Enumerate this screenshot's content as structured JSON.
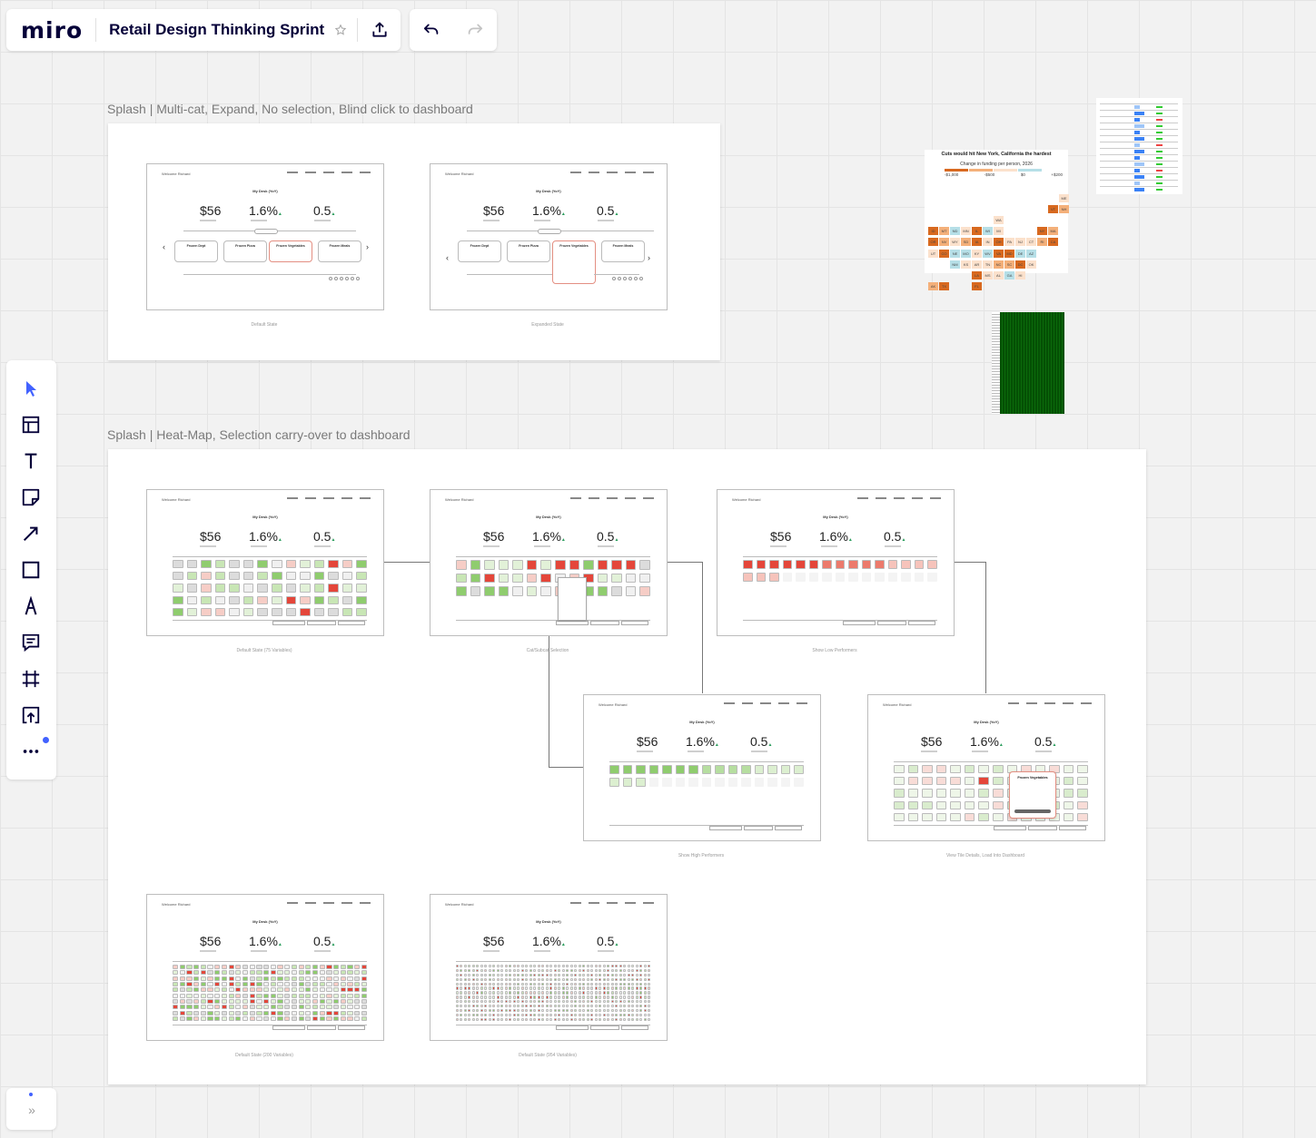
{
  "app": {
    "logo": "miro",
    "board_title": "Retail Design Thinking Sprint"
  },
  "colors": {
    "accent": "#4262ff",
    "frame_bg": "#ffffff",
    "canvas": "#f2f2f2",
    "heat_green": "#8fcc6e",
    "heat_red": "#e4463a"
  },
  "toolbar": {
    "tools": [
      "select-icon",
      "templates-icon",
      "text-icon",
      "sticky-note-icon",
      "connection-line-icon",
      "shape-icon",
      "pen-icon",
      "comment-icon",
      "frame-icon",
      "upload-icon",
      "more-icon"
    ]
  },
  "frames": [
    {
      "label": "Splash | Multi-cat, Expand, No selection, Blind click to dashboard"
    },
    {
      "label": "Splash | Heat-Map, Selection carry-over to dashboard"
    }
  ],
  "wireframe": {
    "welcome": "Welcome Richard",
    "title": "My Desk (YoY)",
    "metrics": [
      "$56",
      "1.6%",
      "0.5"
    ],
    "categories": [
      "Frozen Dept",
      "Frozen Pizza",
      "Frozen Vegetables",
      "Frozen Meals"
    ],
    "expanded_title": "Frozen Vegetables"
  },
  "captions": {
    "f1": [
      "Default State",
      "Expanded State"
    ],
    "f2": [
      "Default State (75 Variables)",
      "Cat/Subcat Selection",
      "Show Low Performers",
      "Show High Performers",
      "View Tile Details, Load Into Dashboard",
      "Default State (200 Variables)",
      "Default State (954 Variables)"
    ]
  },
  "map_title": "Cuts would hit New York, California the hardest",
  "map_subtitle": "Change in funding per person, 2026",
  "map_legend": [
    "-$1,000",
    "-$500",
    "$0",
    "+$200"
  ],
  "map_states": [
    "ME",
    "VT",
    "NH",
    "WA",
    "ID",
    "MT",
    "ND",
    "MN",
    "IL",
    "WI",
    "MI",
    "NY",
    "MA",
    "OR",
    "NV",
    "WY",
    "SD",
    "IA",
    "IN",
    "OH",
    "PA",
    "NJ",
    "CT",
    "RI",
    "CA",
    "UT",
    "CO",
    "NE",
    "MO",
    "KY",
    "WV",
    "VA",
    "MD",
    "DE",
    "AZ",
    "NM",
    "KS",
    "AR",
    "TN",
    "NC",
    "SC",
    "DC",
    "OK",
    "LA",
    "MS",
    "AL",
    "GA",
    "HI",
    "AK",
    "TX",
    "FL"
  ]
}
